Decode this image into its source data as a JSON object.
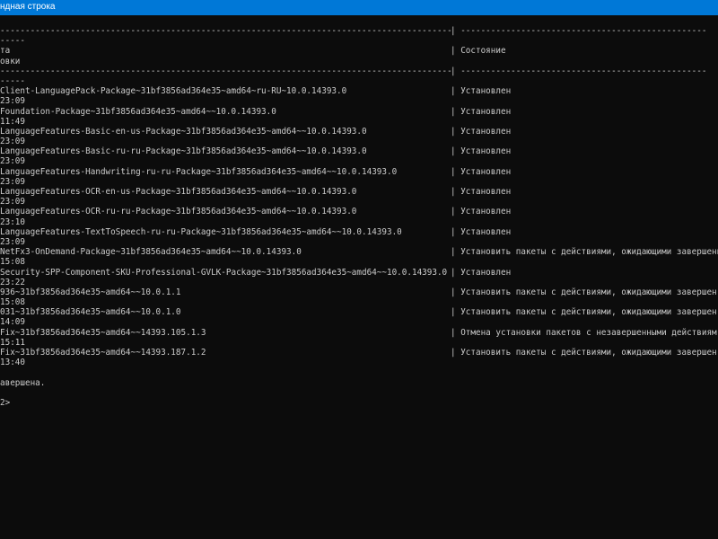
{
  "window": {
    "title": "ндная строка"
  },
  "colors": {
    "titlebar": "#0078d7",
    "background": "#0c0c0c",
    "text": "#cccccc"
  },
  "console": {
    "lines": [
      {
        "a": "------------------------------------------------------------------------------------------",
        "b": "| -------------------------------------------------"
      },
      {
        "a": "-----",
        "b": ""
      },
      {
        "a": "та",
        "b": "| Состояние"
      },
      {
        "a": "овки",
        "b": ""
      },
      {
        "a": "------------------------------------------------------------------------------------------",
        "b": "| -------------------------------------------------"
      },
      {
        "a": "-----",
        "b": ""
      },
      {
        "a": "Client-LanguagePack-Package~31bf3856ad364e35~amd64~ru-RU~10.0.14393.0",
        "b": "| Установлен"
      },
      {
        "a": "23:09",
        "b": ""
      },
      {
        "a": "Foundation-Package~31bf3856ad364e35~amd64~~10.0.14393.0",
        "b": "| Установлен"
      },
      {
        "a": "11:49",
        "b": ""
      },
      {
        "a": "LanguageFeatures-Basic-en-us-Package~31bf3856ad364e35~amd64~~10.0.14393.0",
        "b": "| Установлен"
      },
      {
        "a": "23:09",
        "b": ""
      },
      {
        "a": "LanguageFeatures-Basic-ru-ru-Package~31bf3856ad364e35~amd64~~10.0.14393.0",
        "b": "| Установлен"
      },
      {
        "a": "23:09",
        "b": ""
      },
      {
        "a": "LanguageFeatures-Handwriting-ru-ru-Package~31bf3856ad364e35~amd64~~10.0.14393.0",
        "b": "| Установлен"
      },
      {
        "a": "23:09",
        "b": ""
      },
      {
        "a": "LanguageFeatures-OCR-en-us-Package~31bf3856ad364e35~amd64~~10.0.14393.0",
        "b": "| Установлен"
      },
      {
        "a": "23:09",
        "b": ""
      },
      {
        "a": "LanguageFeatures-OCR-ru-ru-Package~31bf3856ad364e35~amd64~~10.0.14393.0",
        "b": "| Установлен"
      },
      {
        "a": "23:10",
        "b": ""
      },
      {
        "a": "LanguageFeatures-TextToSpeech-ru-ru-Package~31bf3856ad364e35~amd64~~10.0.14393.0",
        "b": "| Установлен"
      },
      {
        "a": "23:09",
        "b": ""
      },
      {
        "a": "NetFx3-OnDemand-Package~31bf3856ad364e35~amd64~~10.0.14393.0",
        "b": "| Установить пакеты с действиями, ожидающими завершени"
      },
      {
        "a": "15:08",
        "b": ""
      },
      {
        "a": "Security-SPP-Component-SKU-Professional-GVLK-Package~31bf3856ad364e35~amd64~~10.0.14393.0",
        "b": "| Установлен"
      },
      {
        "a": "23:22",
        "b": ""
      },
      {
        "a": "936~31bf3856ad364e35~amd64~~10.0.1.1",
        "b": "| Установить пакеты с действиями, ожидающими завершен"
      },
      {
        "a": "15:08",
        "b": ""
      },
      {
        "a": "031~31bf3856ad364e35~amd64~~10.0.1.0",
        "b": "| Установить пакеты с действиями, ожидающими завершен"
      },
      {
        "a": "14:09",
        "b": ""
      },
      {
        "a": "Fix~31bf3856ad364e35~amd64~~14393.105.1.3",
        "b": "| Отмена установки пакетов с незавершенными действиям"
      },
      {
        "a": "15:11",
        "b": ""
      },
      {
        "a": "Fix~31bf3856ad364e35~amd64~~14393.187.1.2",
        "b": "| Установить пакеты с действиями, ожидающими завершен"
      },
      {
        "a": "13:40",
        "b": ""
      },
      {
        "a": "",
        "b": ""
      },
      {
        "a": "авершена.",
        "b": ""
      },
      {
        "a": "",
        "b": ""
      },
      {
        "a": "2>",
        "b": ""
      }
    ]
  }
}
